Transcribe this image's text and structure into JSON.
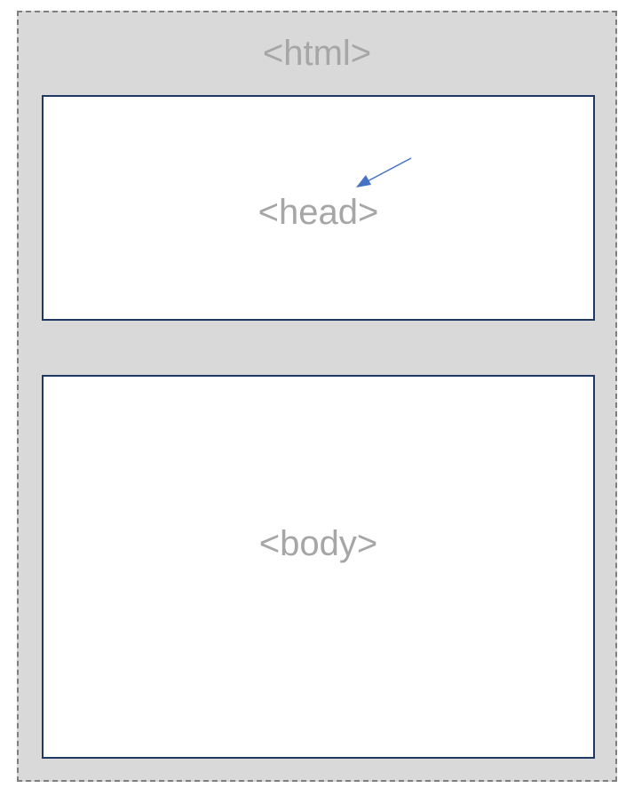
{
  "diagram": {
    "html_label": "<html>",
    "head_label": "<head>",
    "body_label": "<body>"
  },
  "colors": {
    "outer_fill": "#d9d9d9",
    "outer_border": "#7f7f7f",
    "inner_border": "#1f3864",
    "label_text": "#a6a6a6",
    "arrow": "#4472c4"
  }
}
